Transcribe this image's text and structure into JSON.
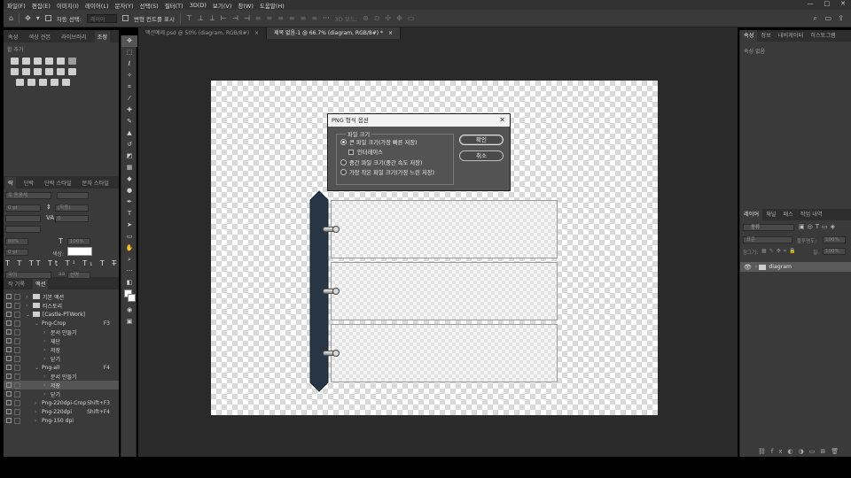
{
  "menu": [
    "파일(F)",
    "편집(E)",
    "이미지(I)",
    "레이어(L)",
    "문자(Y)",
    "선택(S)",
    "필터(T)",
    "3D(D)",
    "보기(V)",
    "창(W)",
    "도움말(H)"
  ],
  "window_controls": [
    "—",
    "□",
    "✕"
  ],
  "options_bar": {
    "auto_select": "자동 선택:",
    "layer_dropdown": "레이어",
    "transform_controls": "변형 컨트롤 표시",
    "mode_3d": "3D 모드:"
  },
  "left_panel": {
    "top_tabs": [
      "속성",
      "색상 견본",
      "라이브러리",
      "조정"
    ],
    "adjust_hint": "할 추가",
    "char_tabs": [
      "락",
      "단락",
      "단락 스타일",
      "문자 스타일"
    ],
    "char_fields": {
      "font": "로 돋움체",
      "size": "0 pt",
      "leading": "(자동)",
      "tracking": "0",
      "vscale": "00%",
      "hscale": "100%",
      "baseline": "0 pt",
      "color_label": "색상:",
      "lang": "국어",
      "aa": "선명"
    },
    "action_tabs": [
      "작 기록",
      "액션"
    ],
    "actions": [
      {
        "label": "기본 액션",
        "level": 0,
        "folder": true,
        "shortcut": ""
      },
      {
        "label": "티스토리",
        "level": 0,
        "folder": true,
        "shortcut": ""
      },
      {
        "label": "[Castle-PTWork]",
        "level": 0,
        "folder": true,
        "shortcut": "",
        "expanded": true
      },
      {
        "label": "Png-Crop",
        "level": 1,
        "folder": false,
        "shortcut": "F3",
        "expanded": true
      },
      {
        "label": "문서 만들기",
        "level": 2,
        "folder": false,
        "shortcut": ""
      },
      {
        "label": "재단",
        "level": 2,
        "folder": false,
        "shortcut": ""
      },
      {
        "label": "저장",
        "level": 2,
        "folder": false,
        "shortcut": ""
      },
      {
        "label": "닫기",
        "level": 2,
        "folder": false,
        "shortcut": ""
      },
      {
        "label": "Png-all",
        "level": 1,
        "folder": false,
        "shortcut": "F4",
        "expanded": true
      },
      {
        "label": "문서 만들기",
        "level": 2,
        "folder": false,
        "shortcut": ""
      },
      {
        "label": "저장",
        "level": 2,
        "folder": false,
        "shortcut": "",
        "selected": true
      },
      {
        "label": "닫기",
        "level": 2,
        "folder": false,
        "shortcut": ""
      },
      {
        "label": "Png-220dpi-Crop",
        "level": 1,
        "folder": false,
        "shortcut": "Shift+F3"
      },
      {
        "label": "Png-220dpi",
        "level": 1,
        "folder": false,
        "shortcut": "Shift+F4"
      },
      {
        "label": "Png-150 dpi",
        "level": 1,
        "folder": false,
        "shortcut": ""
      }
    ]
  },
  "doc_tabs": [
    {
      "label": "액션예제.psd @ 50% (diagram, RGB/8#)",
      "active": false
    },
    {
      "label": "제목 없음-1 @ 66.7% (diagram, RGB/8#) *",
      "active": true
    }
  ],
  "dialog": {
    "title": "PNG 형식 옵션",
    "group_label": "파일 크기",
    "options": [
      {
        "label": "큰 파일 크기(가장 빠른 저장)",
        "checked": true
      },
      {
        "label": "중간 파일 크기(중간 속도 저장)",
        "checked": false
      },
      {
        "label": "가장 작은 파일 크기(가장 느린 저장)",
        "checked": false
      }
    ],
    "interlace_label": "인터레이스",
    "ok": "확인",
    "cancel": "취소"
  },
  "right_panel": {
    "top_tabs": [
      "속성",
      "정보",
      "내비게이터",
      "히스토그램"
    ],
    "props_hint": "속성 없음",
    "layer_tabs": [
      "레이어",
      "채널",
      "패스",
      "작업 내역"
    ],
    "kind_filter": "종류",
    "blend_mode": "표준",
    "opacity_label": "불투명도:",
    "opacity_value": "100%",
    "lock_label": "잠그기:",
    "fill_label": "칠:",
    "fill_value": "100%",
    "layers": [
      {
        "name": "diagram",
        "visible": true,
        "folder": true
      }
    ]
  },
  "colors": {
    "spine": "#263645",
    "accent_selected": "#555555"
  }
}
